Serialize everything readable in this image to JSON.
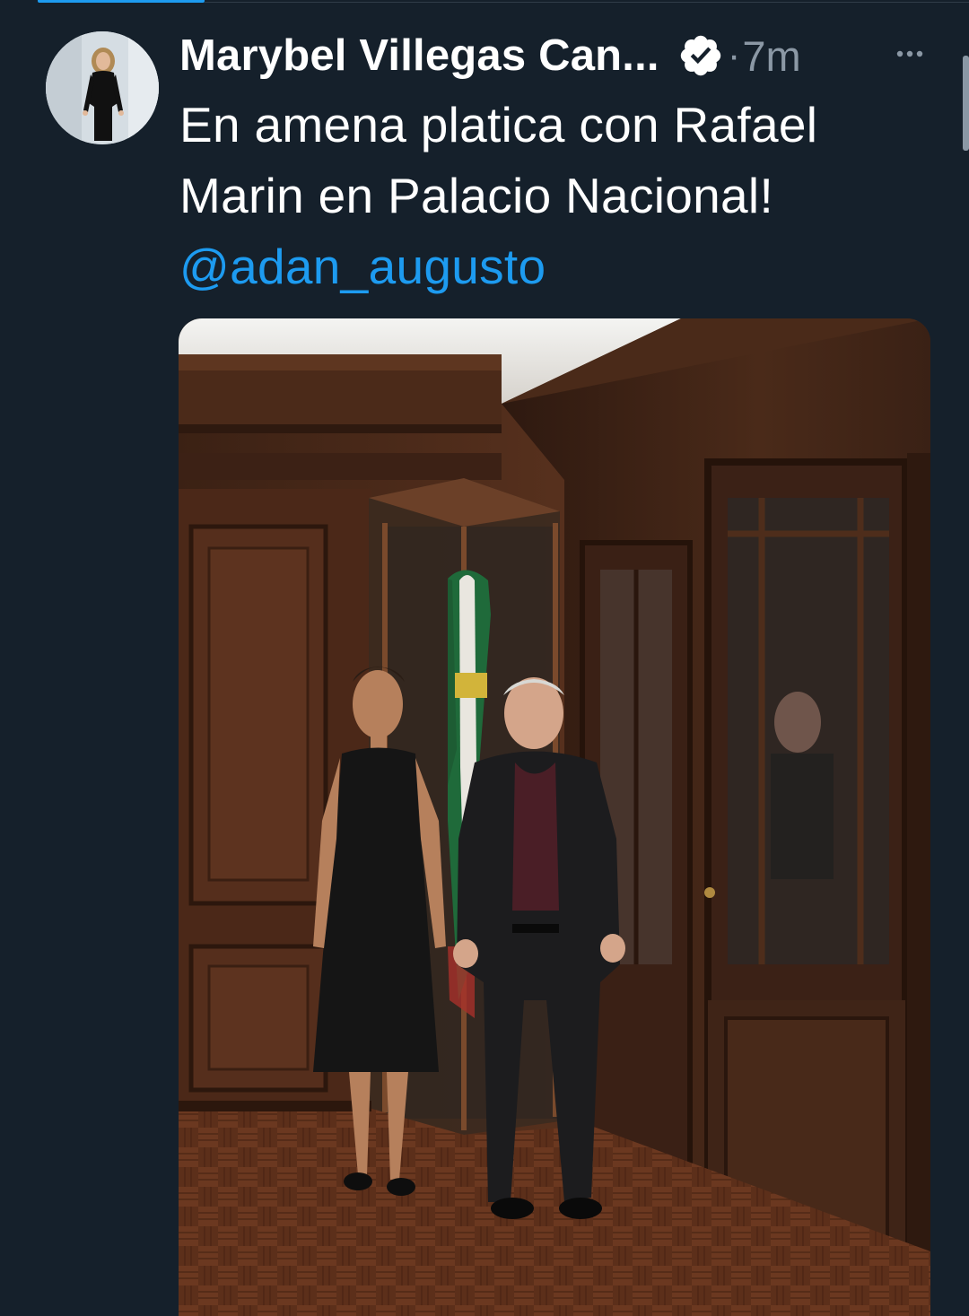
{
  "tweet": {
    "author": {
      "display_name": "Marybel Villegas Can...",
      "verified": true,
      "avatar_icon": "profile-avatar"
    },
    "separator": "·",
    "time_ago": "7m",
    "more_icon": "more-horizontal-icon",
    "text_lines": [
      "En amena platica con Rafael",
      "Marin en Palacio Nacional!"
    ],
    "mention": "@adan_augusto",
    "media": {
      "type": "photo"
    }
  },
  "colors": {
    "background": "#15202b",
    "link": "#1d9bf0",
    "secondary_text": "#8b98a5",
    "primary_text": "#ffffff"
  }
}
